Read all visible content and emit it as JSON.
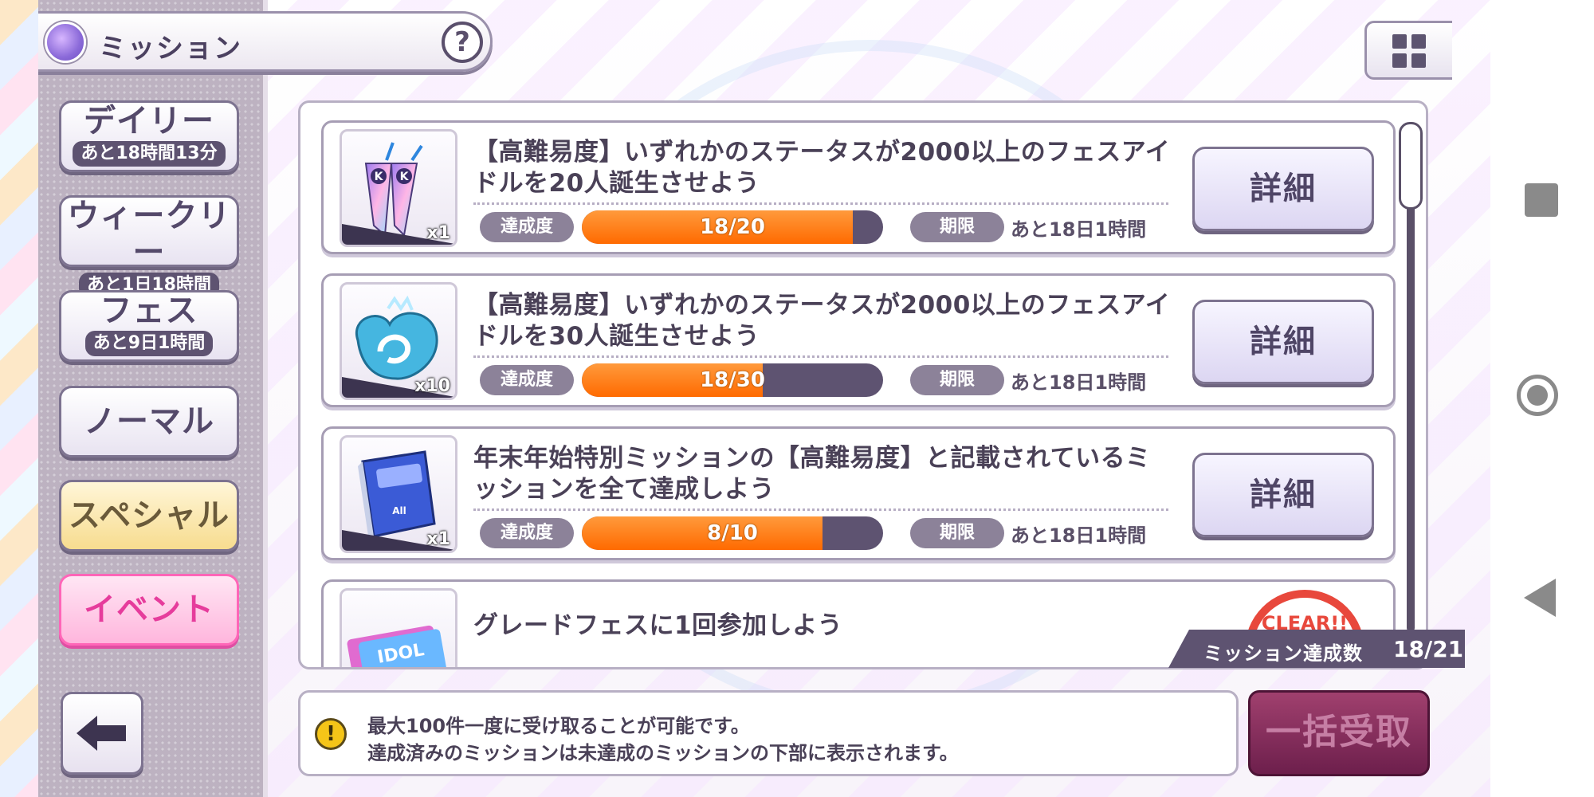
{
  "header": {
    "title": "ミッション",
    "help": "?"
  },
  "sidebar": {
    "daily": {
      "label": "デイリー",
      "remaining": "あと18時間13分"
    },
    "weekly": {
      "label": "ウィークリー",
      "remaining": "あと1日18時間"
    },
    "fes": {
      "label": "フェス",
      "remaining": "あと9日1時間"
    },
    "normal": {
      "label": "ノーマル"
    },
    "special": {
      "label": "スペシャル"
    },
    "event": {
      "label": "イベント"
    }
  },
  "missions": [
    {
      "title": "【高難易度】いずれかのステータスが2000以上のフェスアイドルを20人誕生させよう",
      "reward_icon": "k-sticks-icon",
      "reward_qty": "x1",
      "achv_label": "達成度",
      "progress_text": "18/20",
      "progress": 0.9,
      "limit_label": "期限",
      "limit": "あと18日1時間",
      "detail": "詳細"
    },
    {
      "title": "【高難易度】いずれかのステータスが2000以上のフェスアイドルを30人誕生させよう",
      "reward_icon": "swan-emblem-icon",
      "reward_qty": "x10",
      "achv_label": "達成度",
      "progress_text": "18/30",
      "progress": 0.6,
      "limit_label": "期限",
      "limit": "あと18日1時間",
      "detail": "詳細"
    },
    {
      "title": "年末年始特別ミッションの【高難易度】と記載されているミッションを全て達成しよう",
      "reward_icon": "book-icon",
      "reward_qty": "x1",
      "achv_label": "達成度",
      "progress_text": "8/10",
      "progress": 0.8,
      "limit_label": "期限",
      "limit": "あと18日1時間",
      "detail": "詳細"
    },
    {
      "title": "グレードフェスに1回参加しよう",
      "reward_icon": "idol-ticket-icon",
      "stamp": "CLEAR!!"
    }
  ],
  "summary": {
    "label": "ミッション達成数",
    "value": "18/21"
  },
  "info": {
    "line1": "最大100件一度に受け取ることが可能です。",
    "line2": "達成済みのミッションは未達成のミッションの下部に表示されます。"
  },
  "bulk_button": "一括受取",
  "colors": {
    "progress": "#ff6a00",
    "event": "#ff66b8",
    "special": "#f7dc8f"
  }
}
